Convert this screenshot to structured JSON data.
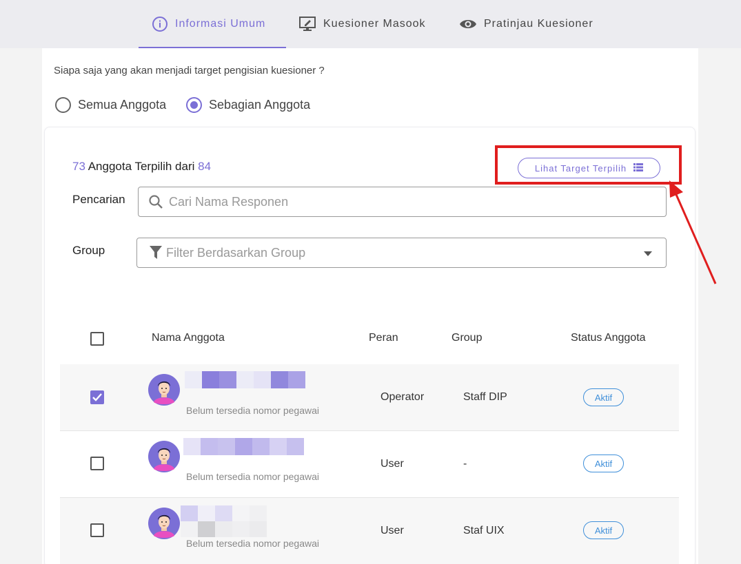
{
  "tabs": [
    {
      "label": "Informasi Umum",
      "icon": "info-icon",
      "active": true
    },
    {
      "label": "Kuesioner Masook",
      "icon": "monitor-edit-icon",
      "active": false
    },
    {
      "label": "Pratinjau Kuesioner",
      "icon": "eye-icon",
      "active": false
    }
  ],
  "target": {
    "question": "Siapa saja yang akan menjadi target pengisian kuesioner ?",
    "options": [
      {
        "label": "Semua Anggota",
        "checked": false
      },
      {
        "label": "Sebagian Anggota",
        "checked": true
      }
    ]
  },
  "selection": {
    "selected": "73",
    "middle": "Anggota Terpilih dari",
    "total": "84",
    "view_button_label": "Lihat Target Terpilih",
    "view_button_icon": "list-icon"
  },
  "search": {
    "label": "Pencarian",
    "placeholder": "Cari Nama Responen",
    "value": ""
  },
  "group_filter": {
    "label": "Group",
    "placeholder": "Filter Berdasarkan Group",
    "value": ""
  },
  "table": {
    "headers": [
      "Nama Anggota",
      "Peran",
      "Group",
      "Status Anggota"
    ],
    "rows": [
      {
        "checked": true,
        "name": "",
        "sub": "Belum tersedia nomor pegawai",
        "role": "Operator",
        "group": "Staff DIP",
        "status": "Aktif"
      },
      {
        "checked": false,
        "name": "",
        "sub": "Belum tersedia nomor pegawai",
        "role": "User",
        "group": "-",
        "status": "Aktif"
      },
      {
        "checked": false,
        "name": "",
        "sub": "Belum tersedia nomor pegawai",
        "role": "User",
        "group": "Staf UIX",
        "status": "Aktif"
      }
    ]
  },
  "colors": {
    "accent": "#7b6fd6",
    "status_blue": "#3f8fd9",
    "highlight_red": "#e01e1e"
  }
}
